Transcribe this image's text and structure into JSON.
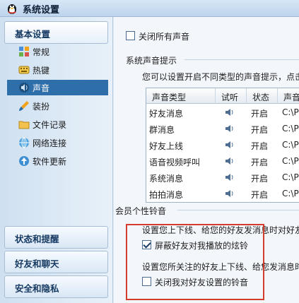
{
  "window": {
    "title": "系统设置"
  },
  "sidebar": {
    "categories": {
      "basic": "基本设置",
      "status": "状态和提醒",
      "friends": "好友和聊天",
      "security": "安全和隐私"
    },
    "items": [
      {
        "label": "常规",
        "icon": "grid-icon"
      },
      {
        "label": "热键",
        "icon": "keyboard-icon"
      },
      {
        "label": "声音",
        "icon": "speaker-icon"
      },
      {
        "label": "装扮",
        "icon": "brush-icon"
      },
      {
        "label": "文件记录",
        "icon": "folder-icon"
      },
      {
        "label": "网络连接",
        "icon": "network-icon"
      },
      {
        "label": "软件更新",
        "icon": "update-icon"
      }
    ]
  },
  "main": {
    "close_all_sound": "关闭所有声音",
    "system_sound_title": "系统声音提示",
    "system_sound_desc": "您可以设置开启不同类型的声音提示，点击",
    "table": {
      "headers": [
        "声音类型",
        "试听",
        "状态",
        "声音文"
      ],
      "rows": [
        {
          "type": "好友消息",
          "status": "开启",
          "path": "C:\\Pr"
        },
        {
          "type": "群消息",
          "status": "开启",
          "path": "C:\\Pr"
        },
        {
          "type": "好友上线",
          "status": "开启",
          "path": "C:\\Pr"
        },
        {
          "type": "语音视频呼叫",
          "status": "开启",
          "path": "C:\\Pr"
        },
        {
          "type": "系统消息",
          "status": "开启",
          "path": "C:\\Pr"
        },
        {
          "type": "拍拍消息",
          "status": "开启",
          "path": "C:\\Pr"
        }
      ]
    },
    "ringtone_title": "会员个性铃音",
    "ringtone_desc1": "设置您上下线、给您的好友发消息时对好友",
    "block_friend_ring": "屏蔽好友对我播放的炫铃",
    "ringtone_desc2": "设置您所关注的好友上下线、给您发消息时",
    "close_friend_ring": "关闭我对好友设置的铃音"
  },
  "colors": {
    "selected_bg": "#2f6fa9",
    "highlight_border": "#d63c2e"
  }
}
